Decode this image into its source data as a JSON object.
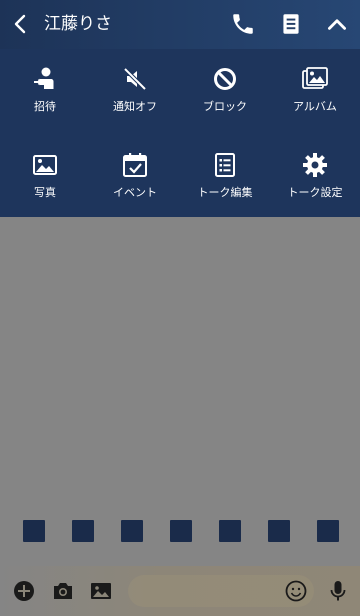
{
  "header": {
    "title": "江藤りさ"
  },
  "menu": {
    "items": [
      {
        "label": "招待",
        "icon": "add-person-icon"
      },
      {
        "label": "通知オフ",
        "icon": "mute-icon"
      },
      {
        "label": "ブロック",
        "icon": "block-icon"
      },
      {
        "label": "アルバム",
        "icon": "album-icon"
      },
      {
        "label": "写真",
        "icon": "photo-icon"
      },
      {
        "label": "イベント",
        "icon": "calendar-icon"
      },
      {
        "label": "トーク編集",
        "icon": "edit-list-icon"
      },
      {
        "label": "トーク設定",
        "icon": "gear-icon"
      }
    ]
  },
  "colors": {
    "header": "#233e66",
    "menu": "#1e355c",
    "chat_bg": "#858585",
    "squares": "#1a2b4a"
  }
}
